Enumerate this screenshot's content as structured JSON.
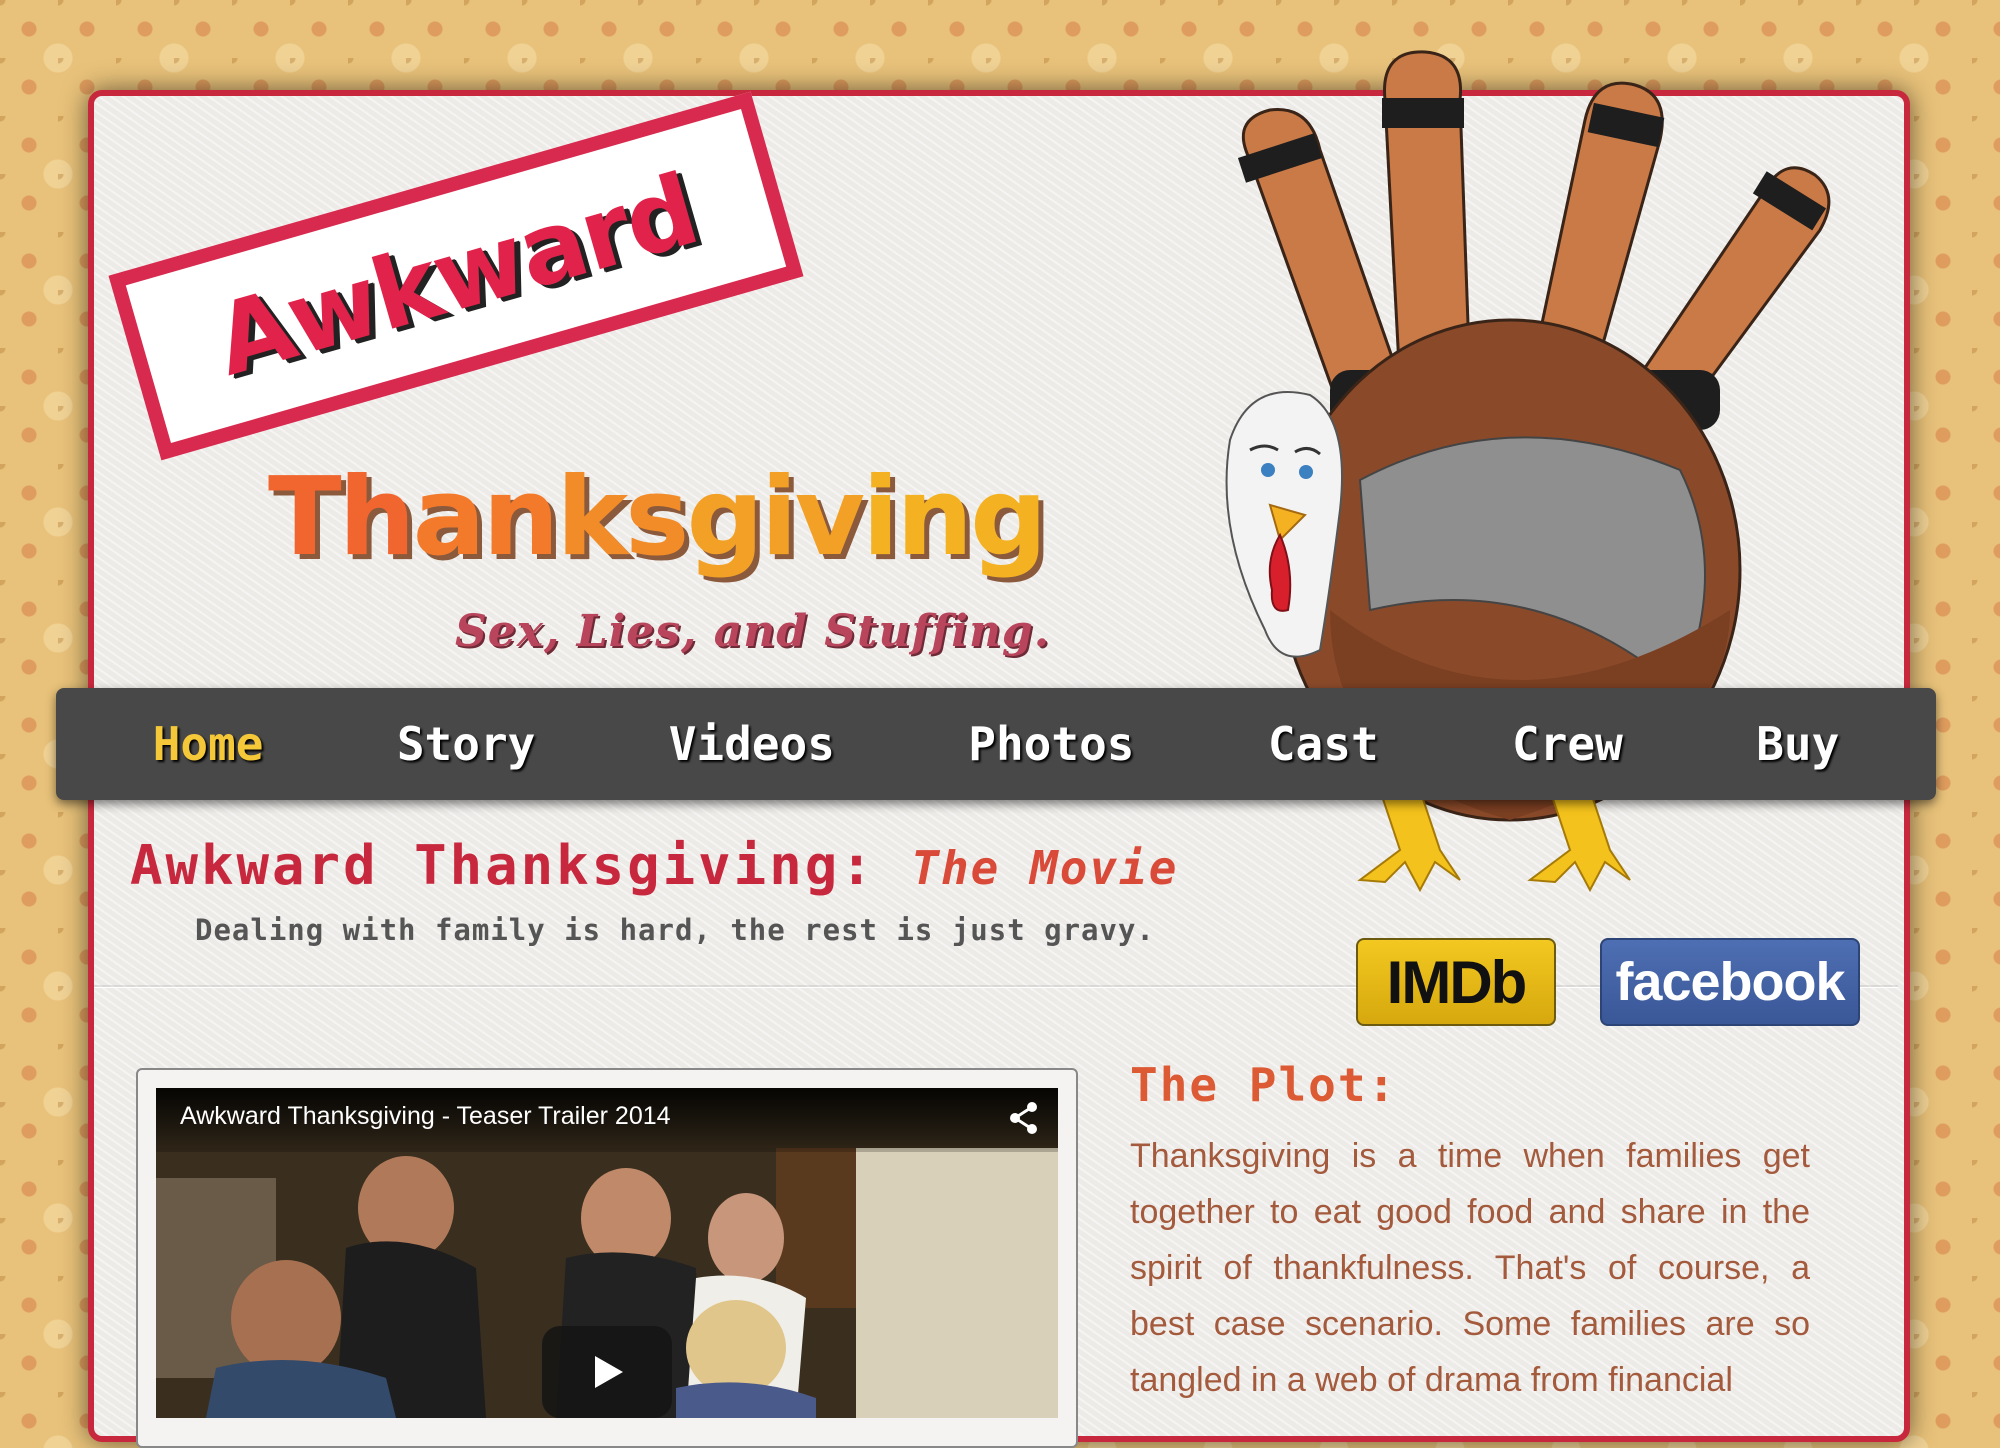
{
  "logo": {
    "line1": "Awkward",
    "line2_parts": [
      "Th",
      "an",
      "ks",
      "giv",
      "ing"
    ],
    "tagline": "Sex, Lies, and Stuffing."
  },
  "nav": {
    "items": [
      {
        "label": "Home",
        "active": true
      },
      {
        "label": "Story"
      },
      {
        "label": "Videos"
      },
      {
        "label": "Photos"
      },
      {
        "label": "Cast"
      },
      {
        "label": "Crew"
      },
      {
        "label": "Buy"
      }
    ],
    "active_color": "#f5c83a"
  },
  "heading": {
    "title": "Awkward Thanksgiving:",
    "subtitle": "The Movie",
    "tagline": "Dealing with family is hard, the rest is just gravy."
  },
  "badges": {
    "imdb": "IMDb",
    "facebook": "facebook"
  },
  "video": {
    "title": "Awkward Thanksgiving - Teaser Trailer 2014"
  },
  "plot": {
    "heading": "The Plot:",
    "text": "Thanksgiving is a time when families get together to eat good food and share in the spirit of thankfulness. That's of course, a best case scenario. Some families are so tangled in a web of drama from financial"
  },
  "colors": {
    "frame_border": "#c8283d",
    "nav_bg": "#484848",
    "title_red": "#c8283d",
    "plot_orange": "#dc5a34"
  }
}
